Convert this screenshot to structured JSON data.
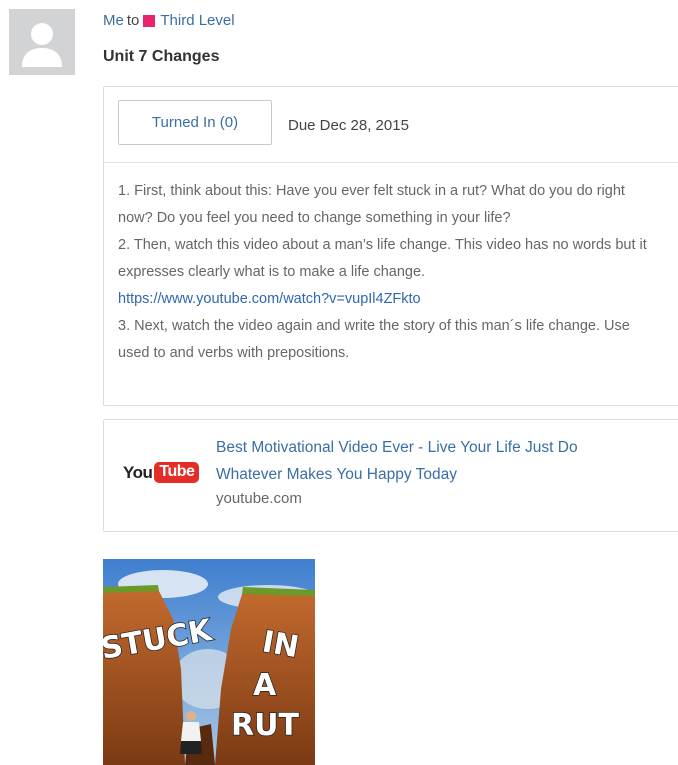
{
  "post": {
    "author": "Me",
    "to_word": "to",
    "group_name": "Third Level",
    "group_color": "#e8246f",
    "title": "Unit 7 Changes"
  },
  "assignment": {
    "turned_in_label": "Turned In (0)",
    "due": "Due Dec 28, 2015",
    "lines": [
      "1. First, think about this: Have you ever felt stuck in a rut? What do you do right now? Do you feel you need to change something in your life?",
      "2. Then, watch this video about a man’s life change. This video has no words but it expresses clearly what is to make a life change.",
      "https://www.youtube.com/watch?v=vupIl4ZFkto",
      "3. Next, watch the video again and write the story of this man´s life change. Use used to and verbs with prepositions."
    ]
  },
  "link_preview": {
    "logo_you": "You",
    "logo_tube": "Tube",
    "title": "Best Motivational Video Ever - Live Your Life Just Do Whatever Makes You Happy Today",
    "domain": "youtube.com"
  },
  "attachment": {
    "image_text": [
      "STUCK",
      "IN",
      "A",
      "RUT"
    ]
  },
  "colors": {
    "link": "#3a6ea5",
    "youtube_red": "#e52d27",
    "avatar_bg": "#d2d3d5"
  }
}
